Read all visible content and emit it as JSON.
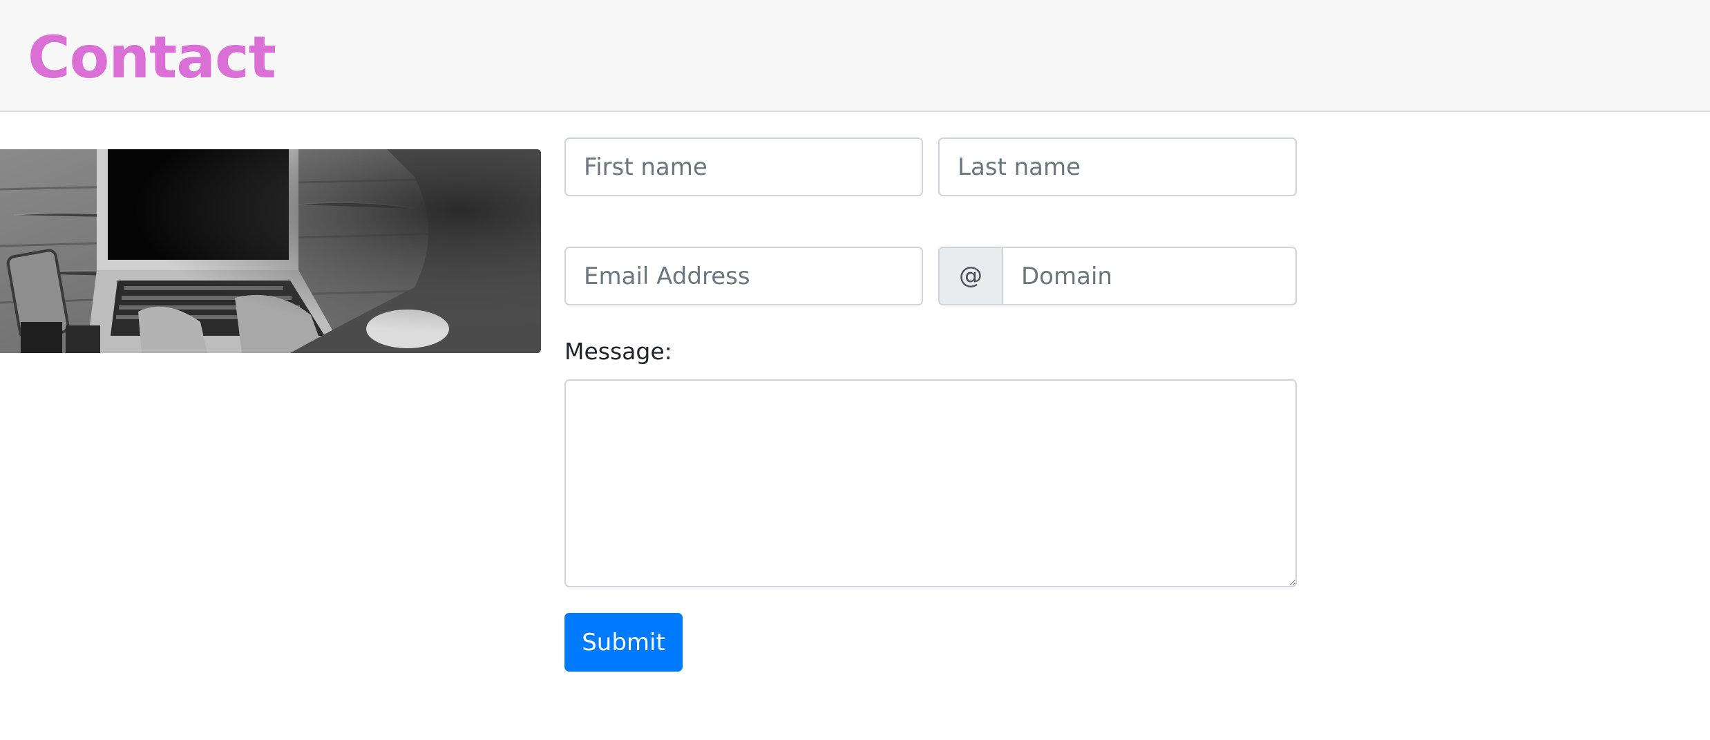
{
  "colors": {
    "accent": "#da70d6",
    "button": "#007bff"
  },
  "header": {
    "title": "Contact"
  },
  "image": {
    "alt": "Person typing on a laptop"
  },
  "form": {
    "first_name_placeholder": "First name",
    "last_name_placeholder": "Last name",
    "email_placeholder": "Email Address",
    "at_symbol": "@",
    "domain_placeholder": "Domain",
    "message_label": "Message:",
    "message_value": "",
    "submit_label": "Submit"
  }
}
